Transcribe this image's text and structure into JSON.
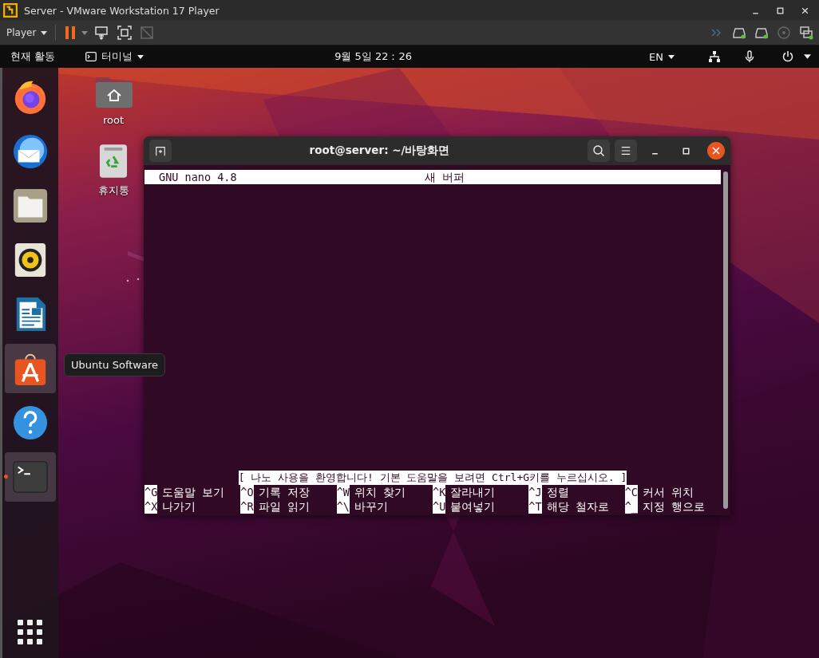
{
  "vmware": {
    "title": "Server - VMware Workstation 17 Player",
    "player_menu": "Player"
  },
  "top_bar": {
    "activities": "현재 활동",
    "app_menu": "터미널",
    "clock": "9월 5일  22：26",
    "language": "EN"
  },
  "desktop_icons": [
    {
      "kind": "folder",
      "label": "root"
    },
    {
      "kind": "trash",
      "label": "휴지통"
    }
  ],
  "dock": [
    {
      "kind": "firefox",
      "highlighted": false,
      "running": false
    },
    {
      "kind": "thunderbird",
      "highlighted": false,
      "running": false
    },
    {
      "kind": "files",
      "highlighted": false,
      "running": false
    },
    {
      "kind": "rhythmbox",
      "highlighted": false,
      "running": false
    },
    {
      "kind": "writer",
      "highlighted": false,
      "running": false
    },
    {
      "kind": "software",
      "highlighted": true,
      "running": false
    },
    {
      "kind": "help",
      "highlighted": false,
      "running": false
    },
    {
      "kind": "terminal",
      "highlighted": true,
      "running": true
    }
  ],
  "tooltip": "Ubuntu Software",
  "terminal": {
    "title": "root@server: ~/바탕화면",
    "nano": {
      "version": "GNU nano 4.8",
      "buffer": "새 버퍼",
      "message": "[ 나노 사용을 환영합니다!  기본 도움말을 보려면 Ctrl+G키를 누르십시오. ]",
      "shortcuts": [
        [
          {
            "key": "^G",
            "label": "도움말 보기"
          },
          {
            "key": "^O",
            "label": "기록 저장"
          },
          {
            "key": "^W",
            "label": "위치 찾기"
          },
          {
            "key": "^K",
            "label": "잘라내기"
          },
          {
            "key": "^J",
            "label": "정렬"
          },
          {
            "key": "^C",
            "label": "커서 위치"
          }
        ],
        [
          {
            "key": "^X",
            "label": "나가기"
          },
          {
            "key": "^R",
            "label": "파일 읽기"
          },
          {
            "key": "^\\",
            "label": "바꾸기"
          },
          {
            "key": "^U",
            "label": "붙여넣기"
          },
          {
            "key": "^T",
            "label": "해당 철자로"
          },
          {
            "key": "^_",
            "label": "지정 행으로"
          }
        ]
      ]
    }
  }
}
